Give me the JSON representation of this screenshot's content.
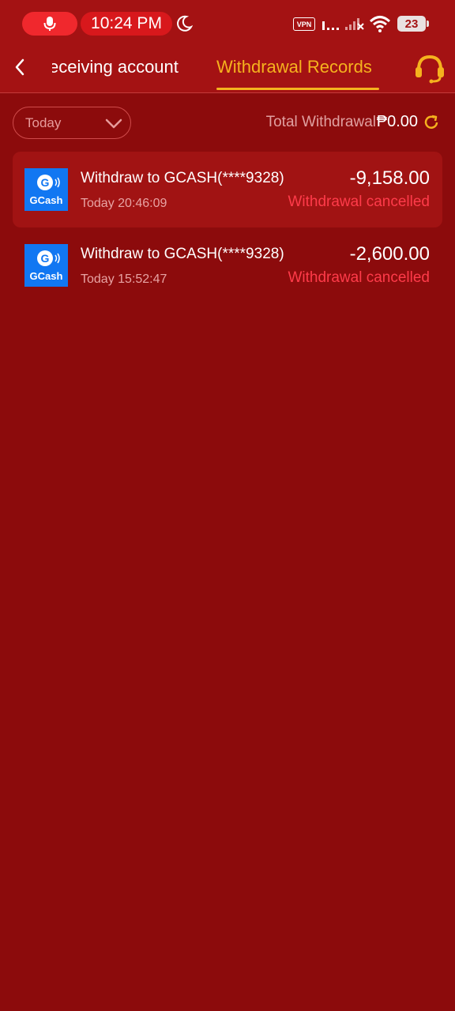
{
  "status_bar": {
    "time": "10:24 PM",
    "vpn_label": "VPN",
    "battery_level": "23",
    "icons": [
      "mic-icon",
      "moon-icon",
      "signal-icon",
      "signal-off-icon",
      "wifi-icon",
      "battery-icon"
    ]
  },
  "nav": {
    "tabs": [
      {
        "label": "eceiving account",
        "active": false
      },
      {
        "label": "Withdrawal Records",
        "active": true
      }
    ],
    "back_icon": "chevron-left-icon",
    "support_icon": "headset-icon"
  },
  "filter": {
    "date_value": "Today",
    "total_label": "Total Withdrawal",
    "total_amount": "₱0.00"
  },
  "records": [
    {
      "method": "GCash",
      "title": "Withdraw to GCASH(****9328)",
      "time": "Today 20:46:09",
      "amount": "-9,158.00",
      "status": "Withdrawal cancelled"
    },
    {
      "method": "GCash",
      "title": "Withdraw to GCASH(****9328)",
      "time": "Today 15:52:47",
      "amount": "-2,600.00",
      "status": "Withdrawal cancelled"
    }
  ],
  "colors": {
    "background": "#8c0b0c",
    "header": "#a41213",
    "accent": "#f5b21e",
    "cancelled": "#ff3b4a",
    "gcash_blue": "#1177f2"
  }
}
